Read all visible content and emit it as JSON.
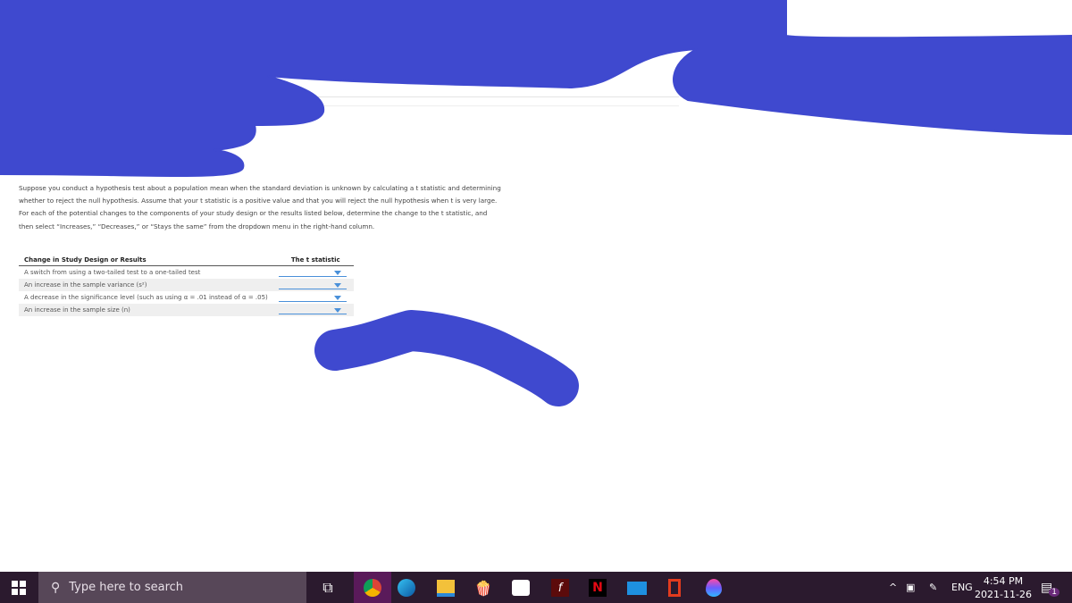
{
  "question": {
    "paragraphs": [
      "Suppose you conduct a hypothesis test about a population mean when the standard deviation is unknown by calculating a t statistic and determining whether to reject the null hypothesis. Assume that your t statistic is a positive value and that you will reject the null hypothesis when t is very large.",
      "For each of the potential changes to the components of your study design or the results listed below, determine the change to the t statistic, and then select “Increases,” “Decreases,” or “Stays the same” from the dropdown menu in the right-hand column."
    ]
  },
  "table": {
    "headers": [
      "Change in Study Design or Results",
      "The t statistic"
    ],
    "rows": [
      {
        "label": "A switch from using a two-tailed test to a one-tailed test",
        "value": ""
      },
      {
        "label": "An increase in the sample variance (s²)",
        "value": ""
      },
      {
        "label": "A decrease in the significance level (such as using α = .01 instead of α = .05)",
        "value": ""
      },
      {
        "label": "An increase in the sample size (n)",
        "value": ""
      }
    ]
  },
  "taskbar": {
    "search_placeholder": "Type here to search",
    "apps": [
      "task-view",
      "chrome",
      "edge",
      "file-explorer",
      "popcorn-time",
      "microsoft-store",
      "flash-player",
      "netflix",
      "mail",
      "office",
      "paint"
    ],
    "language": "ENG",
    "time": "4:54 PM",
    "date": "2021-11-26",
    "notification_count": "1"
  },
  "colors": {
    "scribble": "#3f49cf",
    "taskbar": "#2b1a2e",
    "dropdown": "#4a90d9"
  }
}
